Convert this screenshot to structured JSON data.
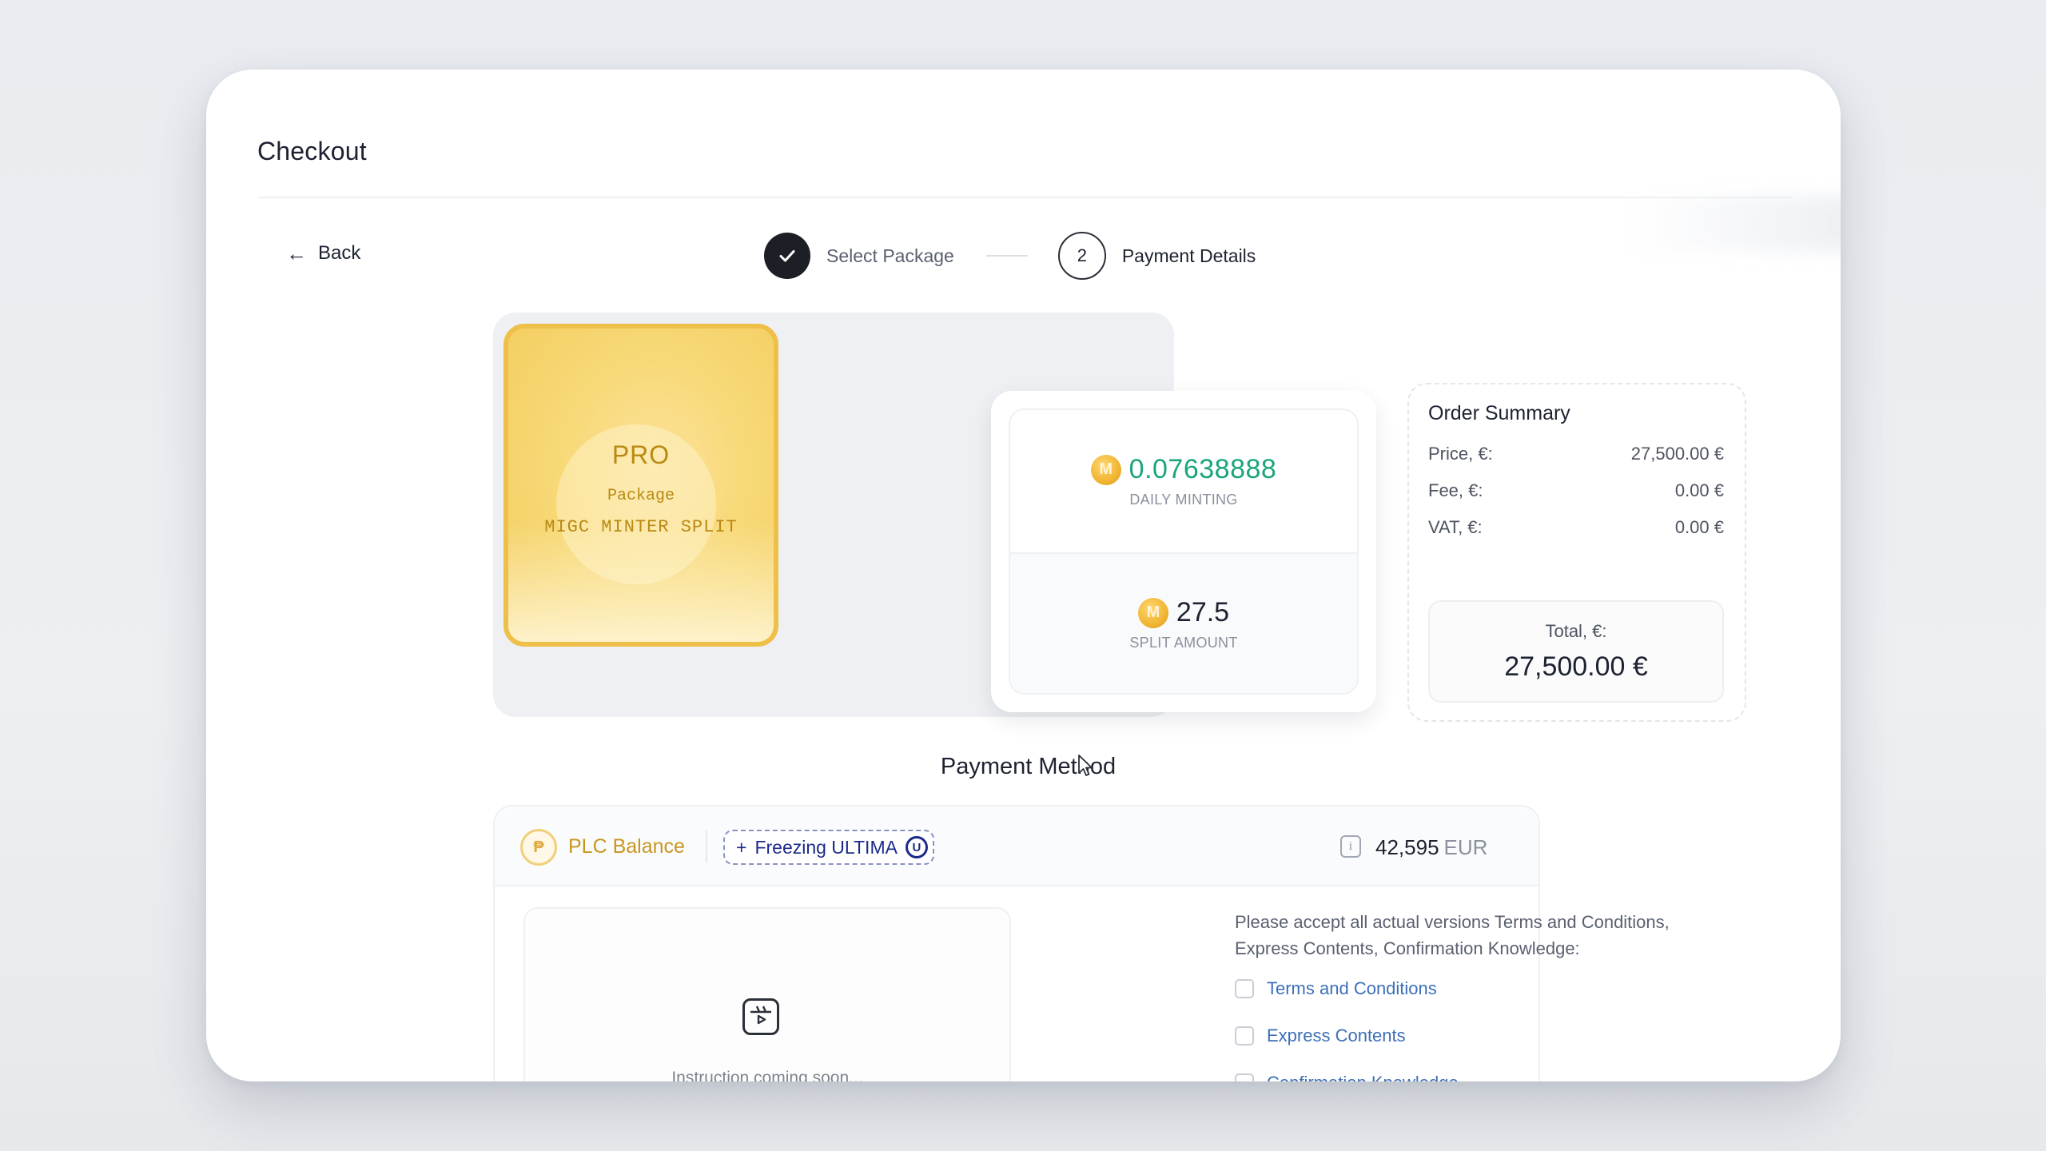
{
  "page": {
    "title": "Checkout",
    "back_label": "Back"
  },
  "stepper": {
    "step1_label": "Select Package",
    "step2_number": "2",
    "step2_label": "Payment Details"
  },
  "package": {
    "tier": "PRO",
    "subtitle": "Package",
    "name": "MIGC MINTER SPLIT",
    "daily_minting_value": "0.07638888",
    "daily_minting_label": "DAILY MINTING",
    "split_amount_value": "27.5",
    "split_amount_label": "SPLIT AMOUNT",
    "coin_glyph": "M"
  },
  "order_summary": {
    "title": "Order Summary",
    "rows": [
      {
        "label": "Price, €:",
        "value": "27,500.00 €"
      },
      {
        "label": "Fee, €:",
        "value": "0.00 €"
      },
      {
        "label": "VAT, €:",
        "value": "0.00 €"
      }
    ],
    "total_label": "Total, €:",
    "total_value": "27,500.00 €"
  },
  "payment_method": {
    "title": "Payment Method",
    "plc_label": "PLC Balance",
    "freeze_label": "Freezing ULTIMA",
    "freeze_prefix": "+",
    "freeze_badge": "U",
    "balance_amount": "42,595",
    "balance_currency": "EUR",
    "instruction_text": "Instruction coming soon...",
    "accept_text": "Please accept all actual versions Terms and Conditions, Express Contents, Confirmation Knowledge:",
    "checkboxes": [
      {
        "label": "Terms and Conditions",
        "checked": false
      },
      {
        "label": "Express Contents",
        "checked": false
      },
      {
        "label": "Confirmation Knowledge",
        "checked": false
      }
    ]
  },
  "icons": {
    "back": "arrow-left-icon",
    "step_done": "check-icon",
    "coin": "migc-coin-icon",
    "plc": "plc-coin-icon",
    "info": "info-icon",
    "video": "video-play-icon",
    "cursor": "mouse-pointer-icon"
  },
  "colors": {
    "accent_gold": "#eec04a",
    "minting_green": "#1aa57f",
    "link_blue": "#3d6fb8",
    "freeze_navy": "#1c2a8a"
  }
}
